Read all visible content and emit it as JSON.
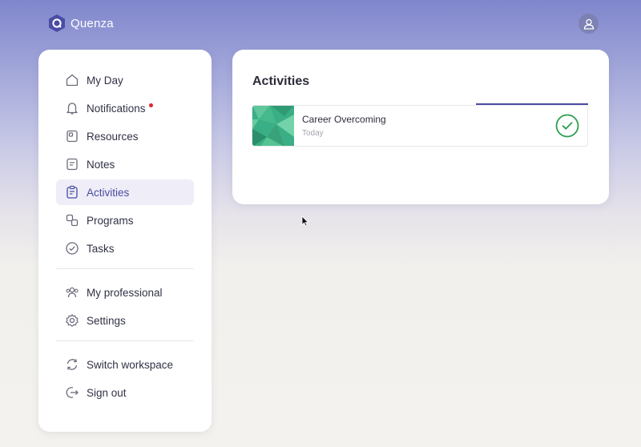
{
  "brand": {
    "name": "Quenza",
    "accent": "#4a4ba0"
  },
  "sidebar": {
    "items": [
      {
        "label": "My Day",
        "icon": "home-icon"
      },
      {
        "label": "Notifications",
        "icon": "bell-icon",
        "has_badge": true
      },
      {
        "label": "Resources",
        "icon": "folder-icon"
      },
      {
        "label": "Notes",
        "icon": "note-icon"
      },
      {
        "label": "Activities",
        "icon": "clipboard-icon",
        "active": true
      },
      {
        "label": "Programs",
        "icon": "shapes-icon"
      },
      {
        "label": "Tasks",
        "icon": "check-circle-icon"
      }
    ],
    "secondary": [
      {
        "label": "My professional",
        "icon": "people-icon"
      },
      {
        "label": "Settings",
        "icon": "gear-icon"
      }
    ],
    "tertiary": [
      {
        "label": "Switch workspace",
        "icon": "refresh-icon"
      },
      {
        "label": "Sign out",
        "icon": "sign-out-icon"
      }
    ]
  },
  "main": {
    "title": "Activities",
    "activities": [
      {
        "name": "Career Overcoming",
        "date": "Today",
        "status": "completed",
        "status_color": "#2e9e4f"
      }
    ]
  }
}
